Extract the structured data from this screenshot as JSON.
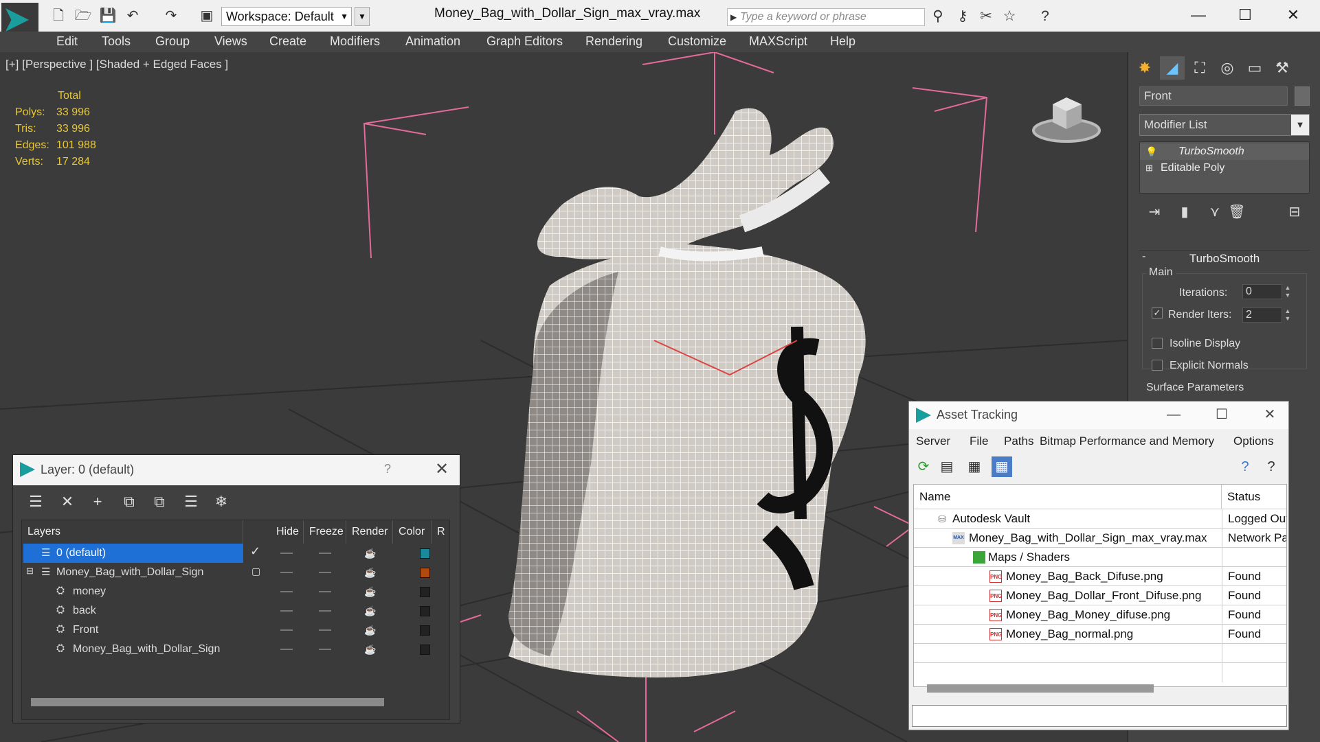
{
  "titlebar": {
    "workspace": "Workspace: Default",
    "document_title": "Money_Bag_with_Dollar_Sign_max_vray.max",
    "search_placeholder": "Type a keyword or phrase"
  },
  "menu": [
    "Edit",
    "Tools",
    "Group",
    "Views",
    "Create",
    "Modifiers",
    "Animation",
    "Graph Editors",
    "Rendering",
    "Customize",
    "MAXScript",
    "Help"
  ],
  "viewport": {
    "label": "[+] [Perspective ] [Shaded + Edged Faces ]",
    "stats_header": "Total",
    "stats": [
      {
        "label": "Polys:",
        "value": "33 996"
      },
      {
        "label": "Tris:",
        "value": "33 996"
      },
      {
        "label": "Edges:",
        "value": "101 988"
      },
      {
        "label": "Verts:",
        "value": "17 284"
      }
    ]
  },
  "command_panel": {
    "object_name": "Front",
    "modifier_list": "Modifier List",
    "stack": [
      "TurboSmooth",
      "Editable Poly"
    ],
    "rollout_title": "TurboSmooth",
    "main_label": "Main",
    "iterations_label": "Iterations:",
    "iterations_value": "0",
    "render_iters_label": "Render Iters:",
    "render_iters_value": "2",
    "isoline_label": "Isoline Display",
    "explicit_normals_label": "Explicit Normals",
    "surface_params_label": "Surface Parameters"
  },
  "layer_window": {
    "title": "Layer: 0 (default)",
    "help": "?",
    "columns": [
      "Layers",
      "Hide",
      "Freeze",
      "Render",
      "Color",
      "R"
    ],
    "rows": [
      {
        "name": "0 (default)",
        "indent": 0,
        "selected": true,
        "color": "#1a8a9a",
        "type": "layer"
      },
      {
        "name": "Money_Bag_with_Dollar_Sign",
        "indent": 0,
        "selected": false,
        "color": "#b04a10",
        "type": "layer"
      },
      {
        "name": "money",
        "indent": 1,
        "selected": false,
        "color": "#222222",
        "type": "object"
      },
      {
        "name": "back",
        "indent": 1,
        "selected": false,
        "color": "#222222",
        "type": "object"
      },
      {
        "name": "Front",
        "indent": 1,
        "selected": false,
        "color": "#222222",
        "type": "object"
      },
      {
        "name": "Money_Bag_with_Dollar_Sign",
        "indent": 1,
        "selected": false,
        "color": "#222222",
        "type": "object"
      }
    ]
  },
  "asset_window": {
    "title": "Asset Tracking",
    "menu": [
      "Server",
      "File",
      "Paths",
      "Bitmap Performance and Memory",
      "Options"
    ],
    "columns": [
      "Name",
      "Status"
    ],
    "rows": [
      {
        "name": "Autodesk Vault",
        "status": "Logged Out",
        "level": 1,
        "icon": "vault"
      },
      {
        "name": "Money_Bag_with_Dollar_Sign_max_vray.max",
        "status": "Network Pat",
        "level": 2,
        "icon": "max"
      },
      {
        "name": "Maps / Shaders",
        "status": "",
        "level": 3,
        "icon": "maps"
      },
      {
        "name": "Money_Bag_Back_Difuse.png",
        "status": "Found",
        "level": 4,
        "icon": "png"
      },
      {
        "name": "Money_Bag_Dollar_Front_Difuse.png",
        "status": "Found",
        "level": 4,
        "icon": "png"
      },
      {
        "name": "Money_Bag_Money_difuse.png",
        "status": "Found",
        "level": 4,
        "icon": "png"
      },
      {
        "name": "Money_Bag_normal.png",
        "status": "Found",
        "level": 4,
        "icon": "png"
      }
    ]
  }
}
